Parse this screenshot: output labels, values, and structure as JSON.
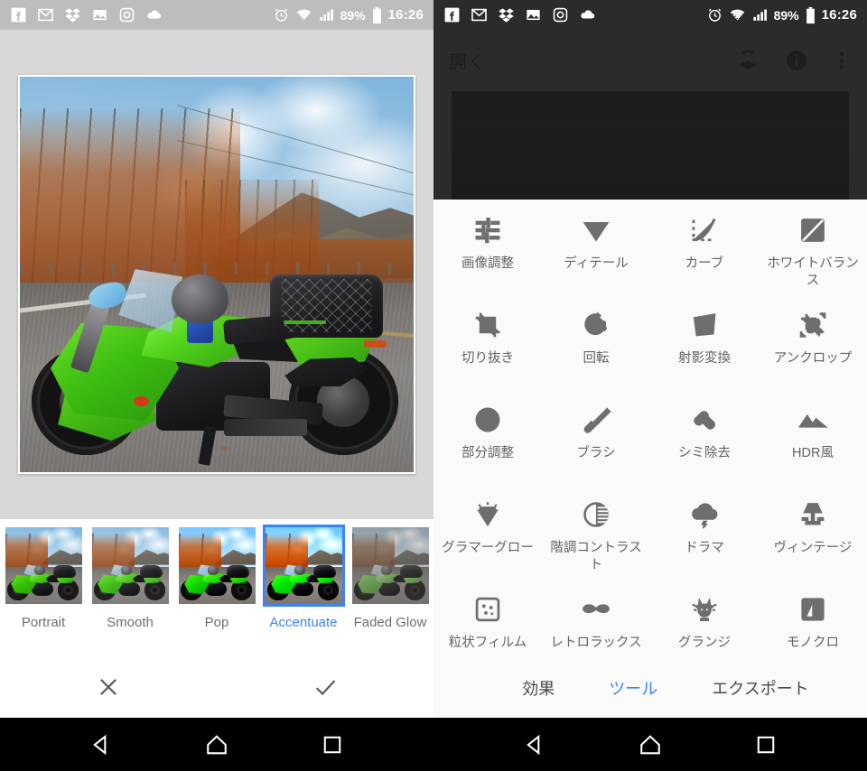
{
  "status_bar": {
    "notification_icons": [
      "facebook-icon",
      "gmail-icon",
      "dropbox-icon",
      "photos-icon",
      "instagram-icon",
      "cloud-icon"
    ],
    "alarm_icon": "alarm-icon",
    "wifi_icon": "wifi-icon",
    "signal_icon": "cellular-signal-icon",
    "battery_percent": "89%",
    "battery_icon": "battery-icon",
    "clock": "16:26"
  },
  "left_panel": {
    "screen_name": "looks-filter-screen",
    "photo": {
      "subject": "green-motorcycle-on-autumn-mountain-road"
    },
    "filters": [
      {
        "label": "Portrait",
        "selected": false
      },
      {
        "label": "Smooth",
        "selected": false
      },
      {
        "label": "Pop",
        "selected": false
      },
      {
        "label": "Accentuate",
        "selected": true
      },
      {
        "label": "Faded Glow",
        "selected": false
      }
    ],
    "actions": [
      {
        "name": "cancel-button",
        "icon": "close-icon"
      },
      {
        "name": "confirm-button",
        "icon": "check-icon"
      }
    ],
    "accent_color": "#3b83f6",
    "canvas_bg": "#d8d8d8"
  },
  "right_panel": {
    "screen_name": "tools-screen",
    "toolbar": {
      "open_label": "開く",
      "stack_icon": "undo-stack-icon",
      "info_icon": "info-icon",
      "menu_icon": "more-vertical-icon"
    },
    "tools": [
      {
        "label": "画像調整",
        "icon": "tune-icon"
      },
      {
        "label": "ディテール",
        "icon": "details-triangle-icon"
      },
      {
        "label": "カーブ",
        "icon": "curves-icon"
      },
      {
        "label": "ホワイトバランス",
        "icon": "white-balance-icon"
      },
      {
        "label": "切り抜き",
        "icon": "crop-icon"
      },
      {
        "label": "回転",
        "icon": "rotate-icon"
      },
      {
        "label": "射影変換",
        "icon": "perspective-icon"
      },
      {
        "label": "アンクロップ",
        "icon": "expand-crop-icon"
      },
      {
        "label": "部分調整",
        "icon": "selective-target-icon"
      },
      {
        "label": "ブラシ",
        "icon": "brush-icon"
      },
      {
        "label": "シミ除去",
        "icon": "healing-icon"
      },
      {
        "label": "HDR風",
        "icon": "hdr-mountain-icon"
      },
      {
        "label": "グラマーグロー",
        "icon": "glamour-glow-icon"
      },
      {
        "label": "階調コントラスト",
        "icon": "tonal-contrast-icon"
      },
      {
        "label": "ドラマ",
        "icon": "drama-cloud-icon"
      },
      {
        "label": "ヴィンテージ",
        "icon": "vintage-lamp-icon"
      },
      {
        "label": "粒状フィルム",
        "icon": "grainy-film-icon"
      },
      {
        "label": "レトロラックス",
        "icon": "retrolux-mustache-icon"
      },
      {
        "label": "グランジ",
        "icon": "grunge-skull-icon"
      },
      {
        "label": "モノクロ",
        "icon": "black-white-icon"
      }
    ],
    "bottom_nav": [
      {
        "label": "効果",
        "active": false
      },
      {
        "label": "ツール",
        "active": true
      },
      {
        "label": "エクスポート",
        "active": false
      }
    ],
    "accent_color": "#3b83f6",
    "sheet_bg": "#fafafa",
    "toolbar_bg": "#2b2b2b"
  },
  "android_nav": [
    {
      "name": "back-button",
      "icon": "back-triangle-icon"
    },
    {
      "name": "home-button",
      "icon": "home-icon"
    },
    {
      "name": "recents-button",
      "icon": "recents-square-icon"
    }
  ]
}
